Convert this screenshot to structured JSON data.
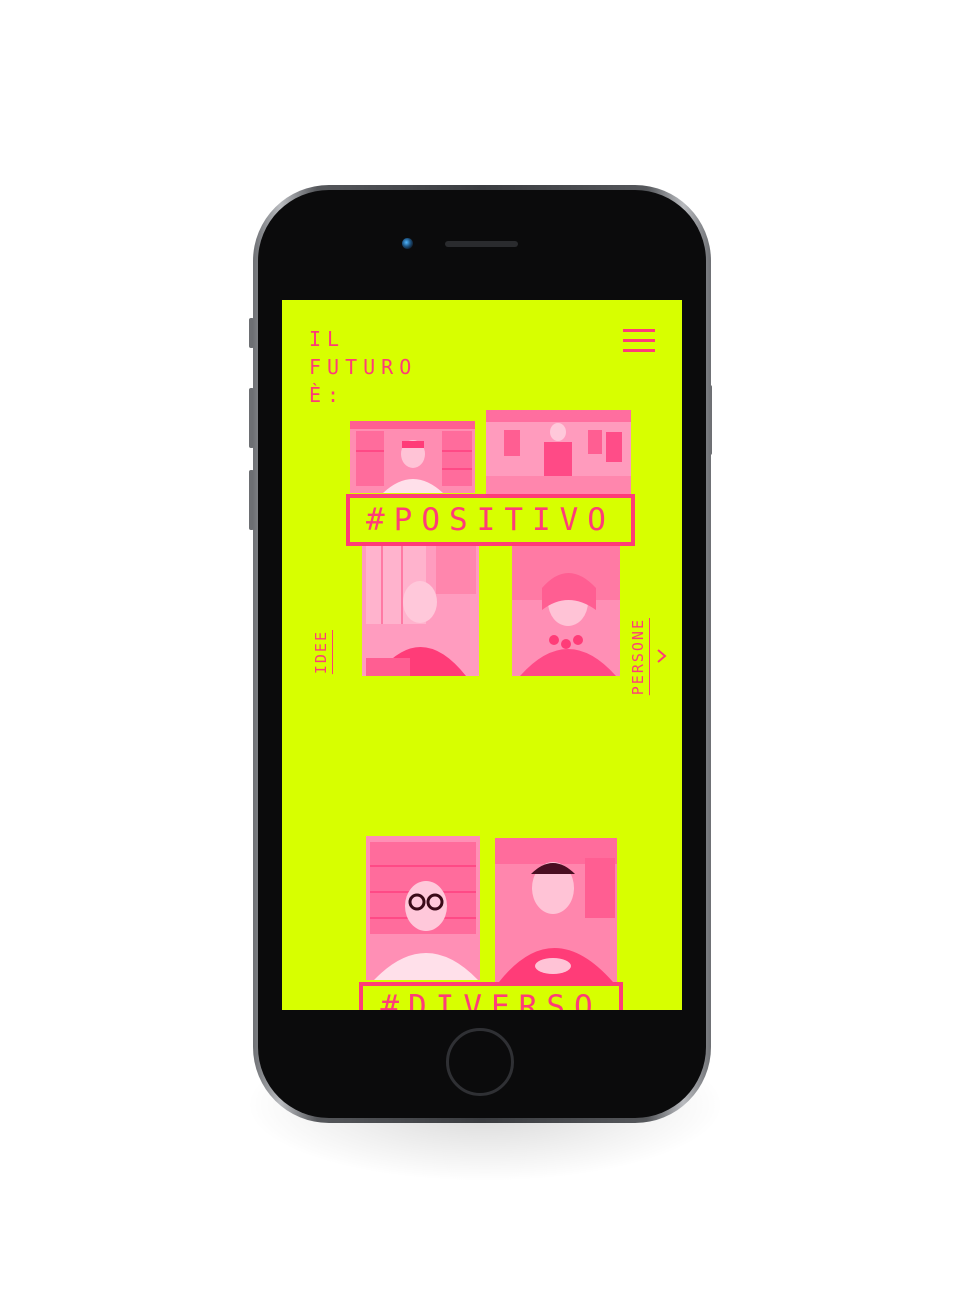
{
  "site": {
    "logo_lines": [
      "IL",
      "FUTURO",
      "È:"
    ],
    "brand_bg": "#d7ff00",
    "accent": "#ff3c78"
  },
  "nav": {
    "menu_icon": "hamburger-menu-icon"
  },
  "sections": [
    {
      "tag": "#POSITIVO",
      "left_link": "IDEE",
      "right_link": "PERSONE",
      "right_icon": "chevron-right-icon"
    },
    {
      "tag": "#DIVERSO"
    }
  ]
}
